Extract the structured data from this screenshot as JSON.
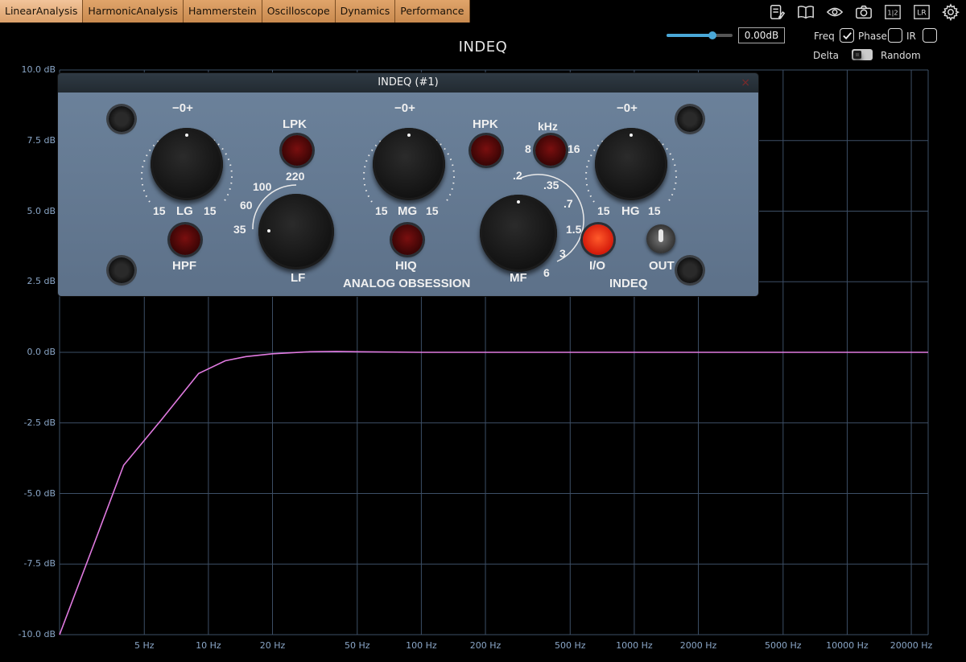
{
  "tabs": [
    {
      "label": "LinearAnalysis",
      "active": true
    },
    {
      "label": "HarmonicAnalysis",
      "active": false
    },
    {
      "label": "Hammerstein",
      "active": false
    },
    {
      "label": "Oscilloscope",
      "active": false
    },
    {
      "label": "Dynamics",
      "active": false
    },
    {
      "label": "Performance",
      "active": false
    }
  ],
  "toolbar_icons": [
    "notes-icon",
    "book-icon",
    "eye-icon",
    "camera-icon",
    "split-channel-icon",
    "lr-icon",
    "gear-icon"
  ],
  "toolbar_text": {
    "split": "1|2",
    "lr": "LR"
  },
  "header": {
    "title": "INDEQ",
    "gain_value": "0.00dB",
    "slider_level": 0.7,
    "freq_label": "Freq",
    "freq_checked": true,
    "phase_label": "Phase",
    "phase_checked": false,
    "ir_label": "IR",
    "ir_checked": false,
    "delta_label": "Delta",
    "random_label": "Random"
  },
  "plugin": {
    "window_title": "INDEQ (#1)",
    "close_glyph": "×",
    "brand": "ANALOG OBSESSION",
    "name": "INDEQ",
    "labels": {
      "lg_scale": "−0+",
      "lg_left": "15",
      "lg_name": "LG",
      "lg_right": "15",
      "mg_scale": "−0+",
      "mg_left": "15",
      "mg_name": "MG",
      "mg_right": "15",
      "hg_scale": "−0+",
      "hg_left": "15",
      "hg_name": "HG",
      "hg_right": "15",
      "lpk": "LPK",
      "hpf": "HPF",
      "hpk": "HPK",
      "hiq": "HIQ",
      "khz": "kHz",
      "khz_8": "8",
      "khz_16": "16",
      "lf_name": "LF",
      "lf_35": "35",
      "lf_60": "60",
      "lf_100": "100",
      "lf_220": "220",
      "mf_name": "MF",
      "mf_02": ".2",
      "mf_035": ".35",
      "mf_07": ".7",
      "mf_15": "1.5",
      "mf_3": "3",
      "mf_6": "6",
      "io": "I/O",
      "out": "OUT"
    }
  },
  "chart_data": {
    "type": "line",
    "title": "",
    "xlabel": "",
    "ylabel": "",
    "x_scale": "log",
    "xlim": [
      2,
      24000
    ],
    "ylim": [
      -10,
      10
    ],
    "grid": true,
    "y_ticks": [
      "10.0 dB",
      "7.5 dB",
      "5.0 dB",
      "2.5 dB",
      "0.0 dB",
      "-2.5 dB",
      "-5.0 dB",
      "-7.5 dB",
      "-10.0 dB"
    ],
    "y_tick_values": [
      10,
      7.5,
      5,
      2.5,
      0,
      -2.5,
      -5,
      -7.5,
      -10
    ],
    "x_ticks": [
      "5 Hz",
      "10 Hz",
      "20 Hz",
      "50 Hz",
      "100 Hz",
      "200 Hz",
      "500 Hz",
      "1000 Hz",
      "2000 Hz",
      "5000 Hz",
      "10000 Hz",
      "20000 Hz"
    ],
    "x_tick_values": [
      5,
      10,
      20,
      50,
      100,
      200,
      500,
      1000,
      2000,
      5000,
      10000,
      20000
    ],
    "series": [
      {
        "color": "#e07ae0",
        "x": [
          2,
          3,
          4,
          6,
          9,
          12,
          15,
          20,
          30,
          40,
          50,
          100,
          1000,
          10000,
          24000
        ],
        "y": [
          -10,
          -6.5,
          -4,
          -2.4,
          -0.75,
          -0.3,
          -0.15,
          -0.05,
          0.02,
          0.03,
          0.02,
          0,
          0,
          0,
          0
        ]
      }
    ],
    "grid_color": "#3d4f66",
    "label_color": "#8aa6c7"
  }
}
